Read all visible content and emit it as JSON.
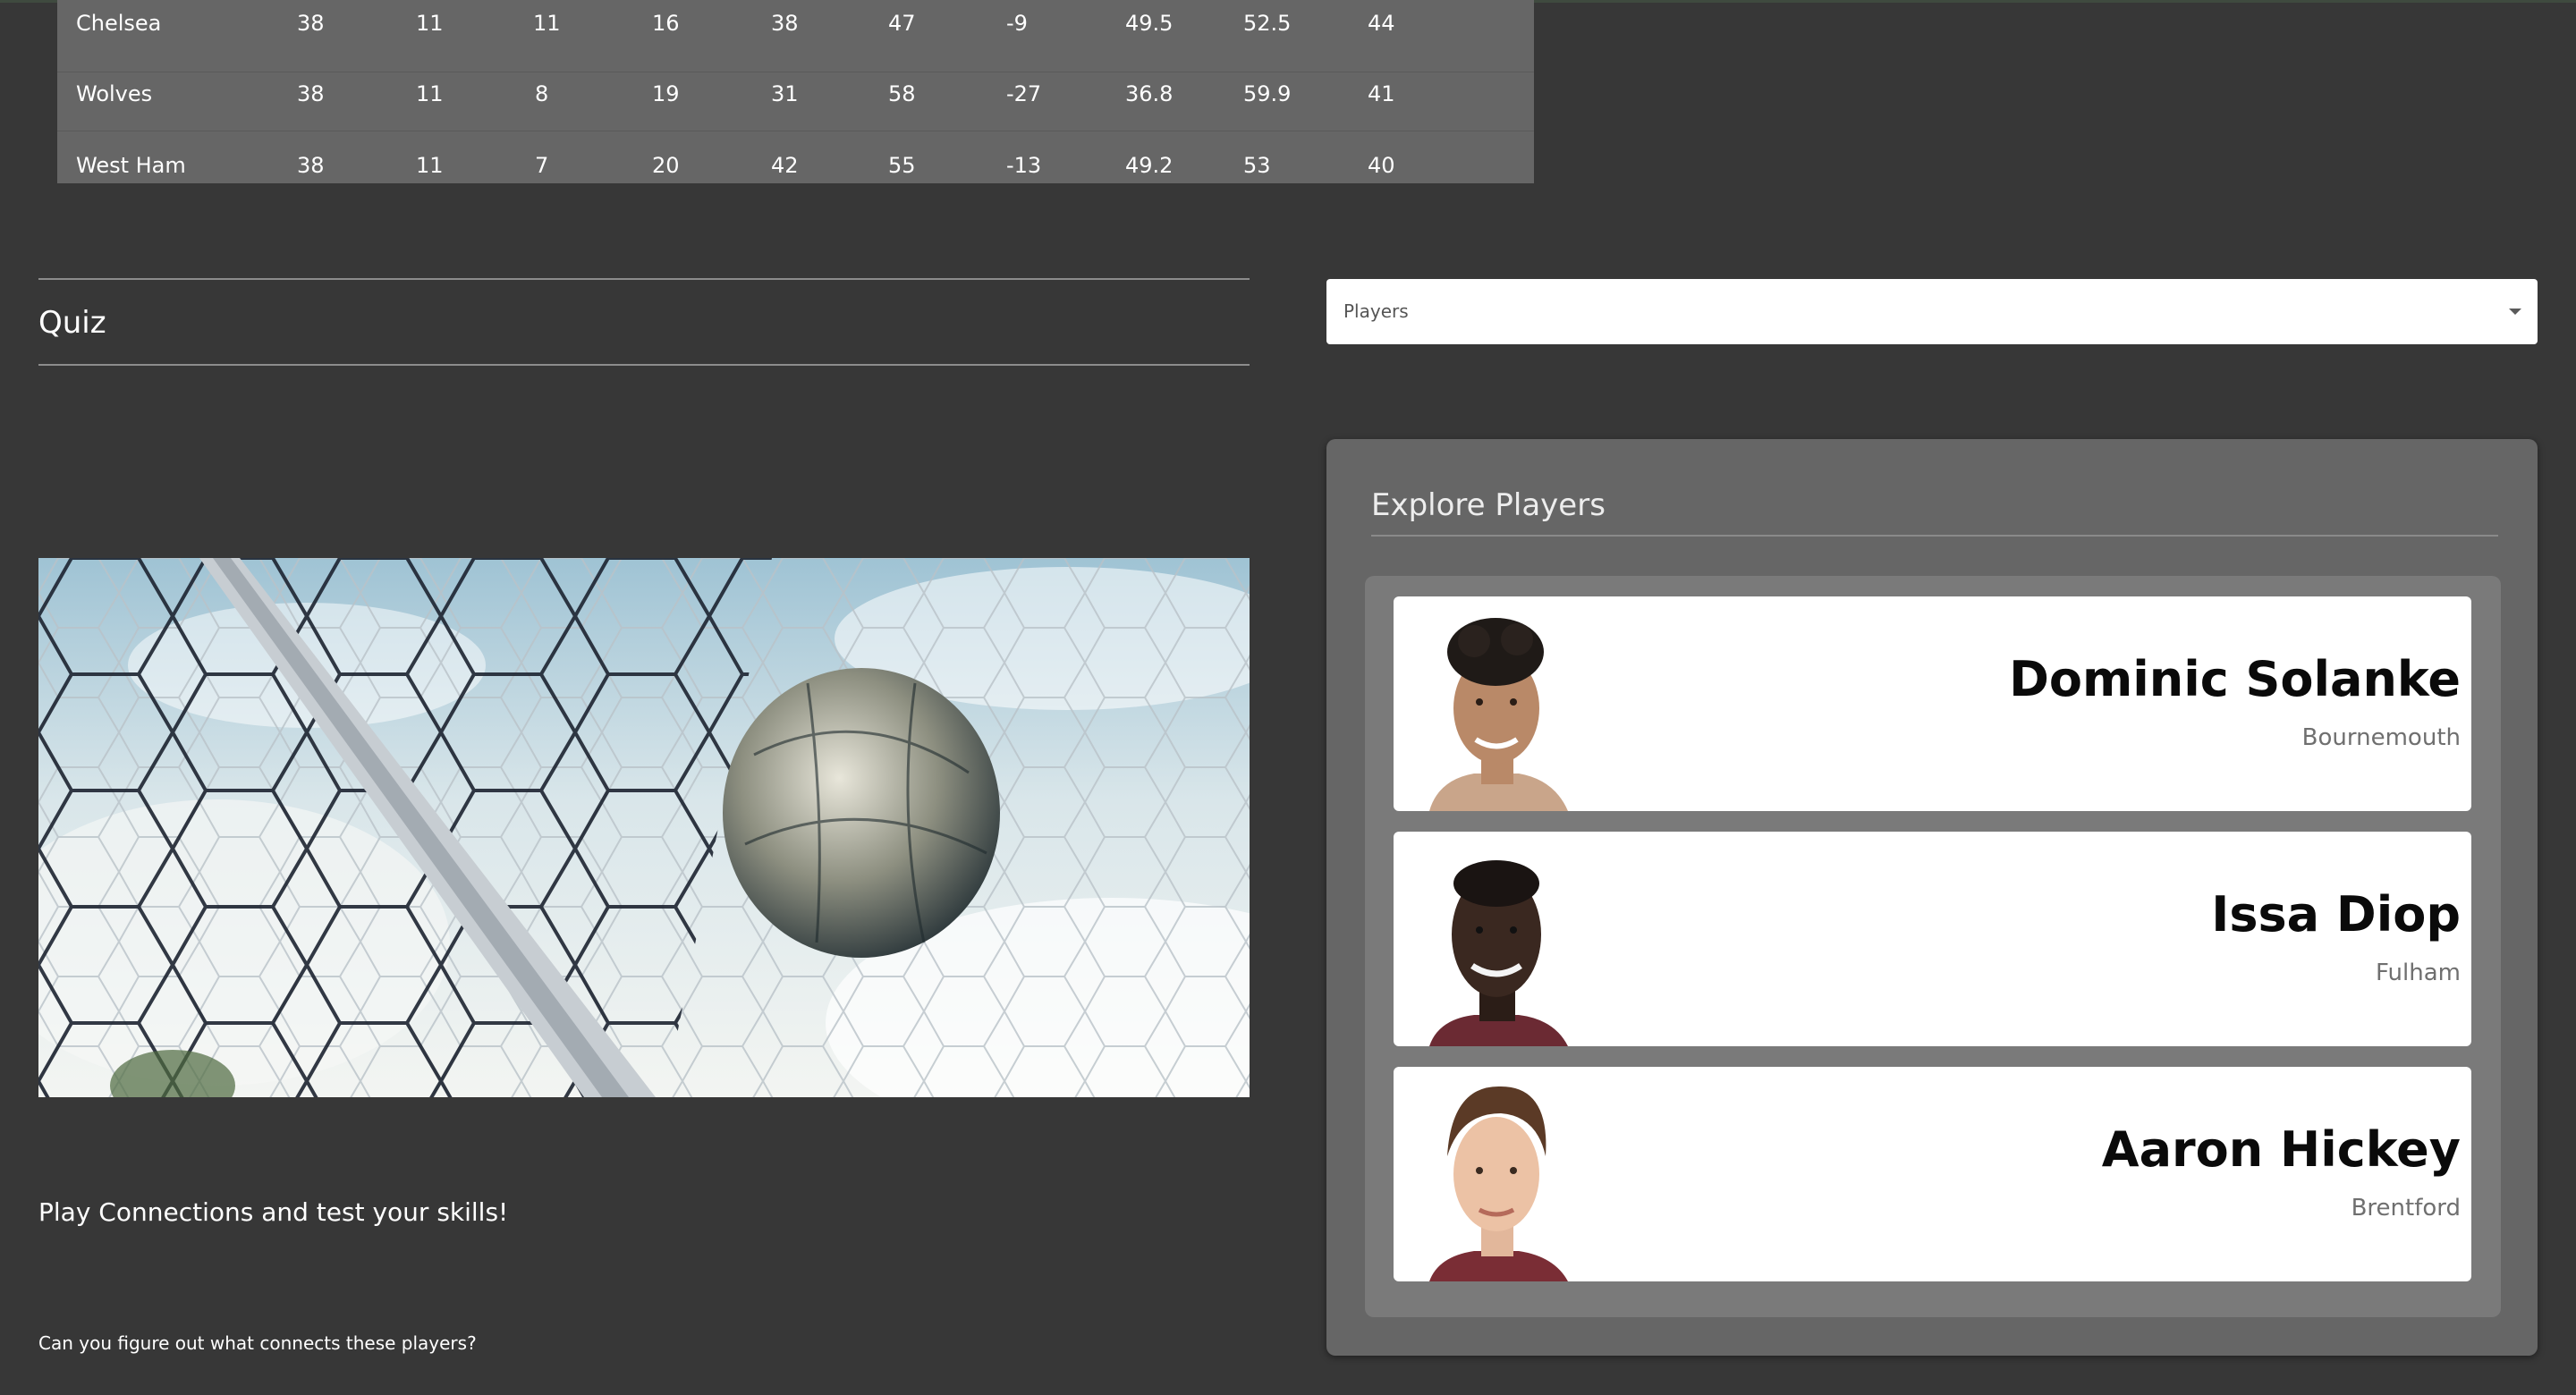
{
  "table": {
    "rows": [
      {
        "team": "Chelsea",
        "cells": [
          "38",
          "11",
          "11",
          "16",
          "38",
          "47",
          "-9",
          "49.5",
          "52.5",
          "44"
        ]
      },
      {
        "team": "Wolves",
        "cells": [
          "38",
          "11",
          "8",
          "19",
          "31",
          "58",
          "-27",
          "36.8",
          "59.9",
          "41"
        ]
      },
      {
        "team": "West Ham",
        "cells": [
          "38",
          "11",
          "7",
          "20",
          "42",
          "55",
          "-13",
          "49.2",
          "53",
          "40"
        ]
      }
    ]
  },
  "quiz": {
    "title": "Quiz",
    "play_text": "Play Connections and test your skills!",
    "sub_text": "Can you figure out what connects these players?"
  },
  "select": {
    "value": "Players"
  },
  "explore": {
    "title": "Explore Players",
    "players": [
      {
        "name": "Dominic Solanke",
        "club": "Bournemouth"
      },
      {
        "name": "Issa Diop",
        "club": "Fulham"
      },
      {
        "name": "Aaron Hickey",
        "club": "Brentford"
      }
    ]
  },
  "colors": {
    "page_background": "#373737",
    "table_background": "#666666",
    "panel_background": "#666666",
    "card_background": "#ffffff"
  },
  "icons": {
    "select_caret": "caret-down-icon"
  }
}
